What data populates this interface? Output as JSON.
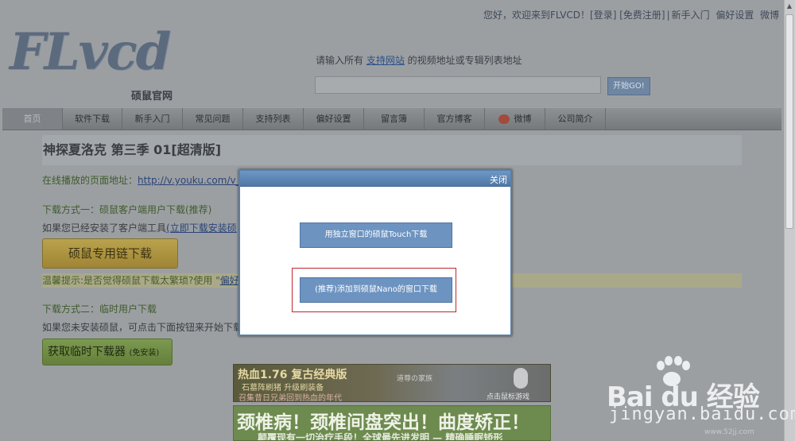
{
  "topbar": {
    "greeting": "您好，欢迎来到FLVCD！",
    "login": "[登录]",
    "register": "[免费注册]",
    "sep": "|",
    "newbie": "新手入门",
    "prefs": "偏好设置",
    "weibo": "微博"
  },
  "logo": {
    "main": "FLvcd",
    "sub": "硕鼠官网"
  },
  "search": {
    "hint_before": "请输入所有 ",
    "hint_link": "支持网站",
    "hint_after": " 的视频地址或专辑列表地址",
    "value": "",
    "button": "开始GO!"
  },
  "nav": {
    "items": [
      {
        "label": "首页",
        "width": 3
      },
      {
        "label": "软件下载"
      },
      {
        "label": "新手入门"
      },
      {
        "label": "常见问题"
      },
      {
        "label": "支持列表"
      },
      {
        "label": "偏好设置"
      },
      {
        "label": "留言簿"
      },
      {
        "label": "官方博客"
      },
      {
        "label": "微博"
      },
      {
        "label": "公司简介"
      }
    ]
  },
  "content": {
    "title": "神探夏洛克 第三季 01[超清版]",
    "online_label": "在线播放的页面地址：",
    "online_url": "http://v.youku.com/v_sh",
    "method1_title": "下载方式一：硕鼠客户端用户下载(推荐)",
    "method1_desc": "如果您已经安装了客户端工具",
    "method1_link": "(立即下载安装硕",
    "download_btn1": "硕鼠专用链下载",
    "tip_text": "温馨提示:是否觉得硕鼠下载太繁琐?使用 \"",
    "tip_link": "偏好",
    "method2_title": "下载方式二：临时用户下载",
    "method2_desc": "如果您未安装硕鼠，可点击下面按钮来开始下载",
    "download_btn2": "获取临时下载器",
    "download_btn2_small": "(免安装)"
  },
  "ads": {
    "ad1_title": "热血1.76 复古经典版",
    "ad1_sub": "石墓阵刷猪 升级刷装备",
    "ad1_sub2": "召集昔日兄弟回到热血的年代",
    "ad1_game": "道尊の家族",
    "ad1_click": "点击鼠标游戏",
    "ad2_title": "颈椎病！颈椎间盘突出！曲度矫正！",
    "ad2_sub": "颠覆现有一切治疗手段！全球最先进发明 — 精确睡眠矫形"
  },
  "modal": {
    "close": "关闭",
    "option_touch": "用独立窗口的硕鼠Touch下载",
    "option_nano": "(推荐)添加到硕鼠Nano的窗口下载"
  },
  "watermark": {
    "brand": "Bai du 经验",
    "domain": "jingyan.baidu.com",
    "site": "www.52jj.com"
  }
}
